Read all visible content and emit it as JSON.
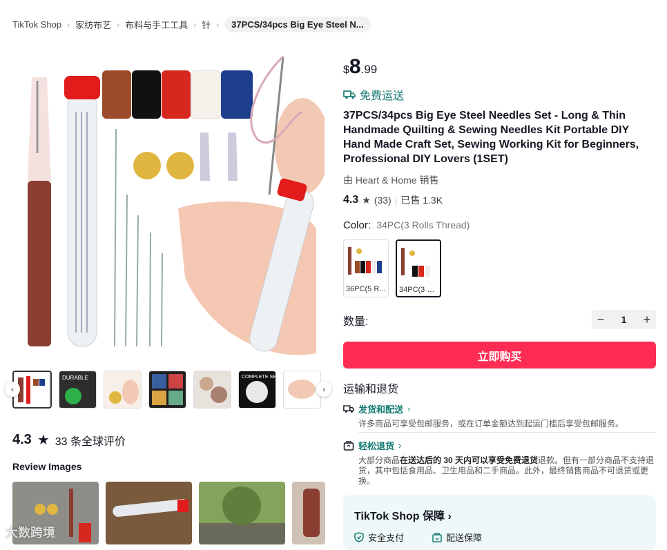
{
  "breadcrumb": {
    "items": [
      "TikTok Shop",
      "家纺布艺",
      "布料与手工工具",
      "针"
    ],
    "current": "37PCS/34pcs Big Eye Steel N..."
  },
  "gallery": {
    "thumb_count": 7
  },
  "reviews": {
    "score": "4.3",
    "count_text": "33 条全球评价",
    "images_title": "Review Images"
  },
  "watermark": "大数跨境",
  "product": {
    "currency": "$",
    "price_int": "8",
    "price_dec": ".99",
    "free_shipping": "免费运送",
    "title": "37PCS/34pcs Big Eye Steel Needles Set - Long & Thin Handmade Quilting & Sewing Needles Kit Portable DIY Hand Made Craft Set, Sewing Working Kit for Beginners, Professional DIY Lovers (1SET)",
    "seller": "由 Heart & Home 销售",
    "rating": "4.3",
    "rating_count": "(33)",
    "sold": "已售 1.3K",
    "color_label": "Color:",
    "color_value": "34PC(3 Rolls Thread)",
    "variants": [
      {
        "label": "36PC(5 R..."
      },
      {
        "label": "34PC(3 R..."
      }
    ],
    "qty_label": "数量:",
    "qty_value": "1",
    "buy_label": "立即购买"
  },
  "shipping": {
    "title": "运输和退货",
    "delivery_head": "发货和配送",
    "delivery_desc": "许多商品可享受包邮服务，或在订单金额达到起运门槛后享受包邮服务。",
    "returns_head": "轻松退货",
    "returns_desc_pre": "大部分商品",
    "returns_desc_bold": "在送达后的 30 天内可以享受免费退货",
    "returns_desc_post": "退款。但有一部分商品不支持退货，其中包括食用品、卫生用品和二手商品。此外，最终销售商品不可退货或更换。"
  },
  "guarantee": {
    "title": "TikTok Shop 保障",
    "items": [
      "安全支付",
      "配送保障"
    ]
  },
  "colors": {
    "accent_red": "#fe2c55",
    "accent_teal": "#137a72"
  }
}
